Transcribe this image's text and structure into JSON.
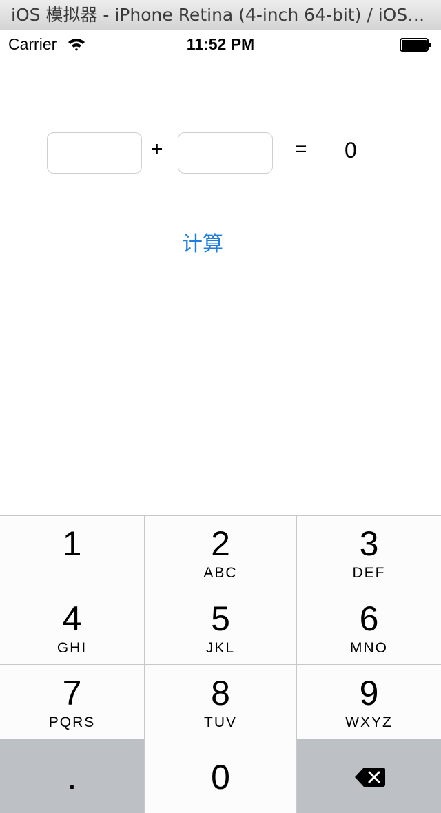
{
  "window": {
    "title": "iOS 模拟器 - iPhone Retina (4-inch 64-bit) / iOS…"
  },
  "statusbar": {
    "carrier": "Carrier",
    "time": "11:52 PM",
    "wifi_icon": "wifi-icon",
    "battery_icon": "battery-icon"
  },
  "form": {
    "field1_value": "",
    "plus": "+",
    "field2_value": "",
    "equals": "=",
    "result": "0",
    "calculate_label": "计算",
    "accent_color": "#1f7fe0"
  },
  "keypad": {
    "keys": [
      {
        "digit": "1",
        "letters": ""
      },
      {
        "digit": "2",
        "letters": "ABC"
      },
      {
        "digit": "3",
        "letters": "DEF"
      },
      {
        "digit": "4",
        "letters": "GHI"
      },
      {
        "digit": "5",
        "letters": "JKL"
      },
      {
        "digit": "6",
        "letters": "MNO"
      },
      {
        "digit": "7",
        "letters": "PQRS"
      },
      {
        "digit": "8",
        "letters": "TUV"
      },
      {
        "digit": "9",
        "letters": "WXYZ"
      },
      {
        "digit": ".",
        "letters": ""
      },
      {
        "digit": "0",
        "letters": ""
      }
    ],
    "backspace_icon": "backspace-icon"
  }
}
